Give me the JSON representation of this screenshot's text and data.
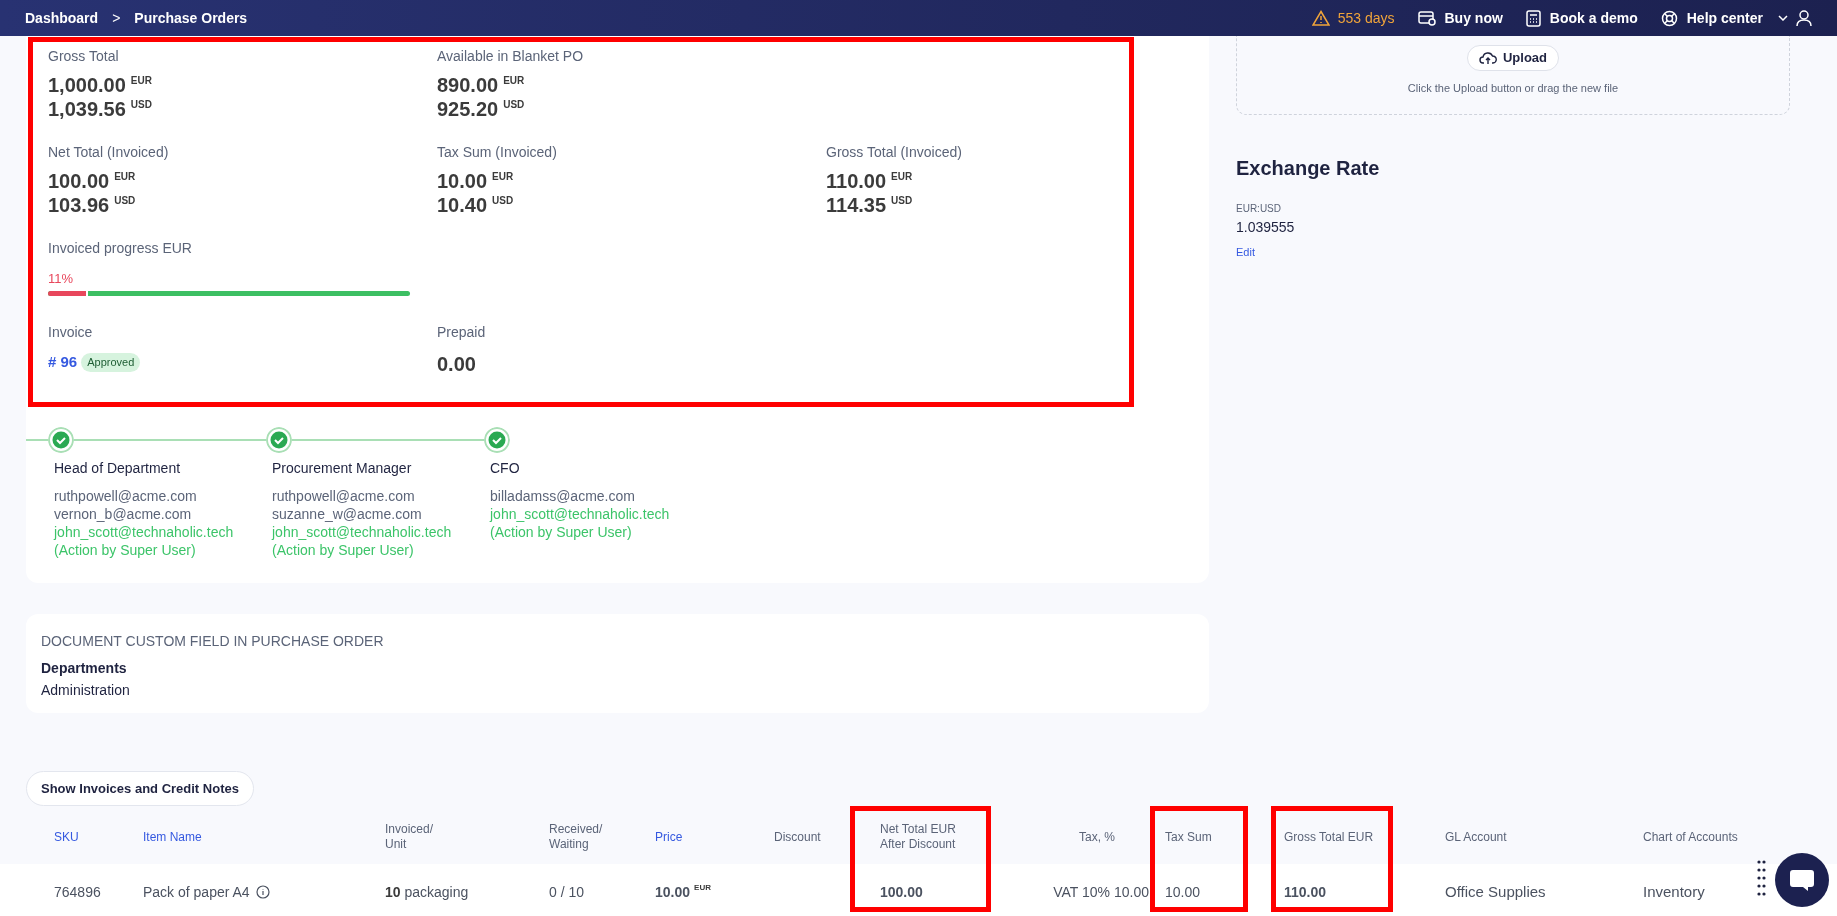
{
  "topbar": {
    "breadcrumbs": [
      "Dashboard",
      "Purchase Orders"
    ],
    "separator": ">",
    "trial": "553 days",
    "actions": [
      "Buy now",
      "Book a demo",
      "Help center"
    ]
  },
  "summary": {
    "rows": [
      {
        "fields": [
          {
            "label": "Gross Total",
            "amounts": [
              {
                "value": "1,000.00",
                "currency": "EUR"
              },
              {
                "value": "1,039.56",
                "currency": "USD"
              }
            ]
          },
          {
            "label": "Available in Blanket PO",
            "amounts": [
              {
                "value": "890.00",
                "currency": "EUR"
              },
              {
                "value": "925.20",
                "currency": "USD"
              }
            ]
          }
        ]
      },
      {
        "fields": [
          {
            "label": "Net Total (Invoiced)",
            "amounts": [
              {
                "value": "100.00",
                "currency": "EUR"
              },
              {
                "value": "103.96",
                "currency": "USD"
              }
            ]
          },
          {
            "label": "Tax Sum (Invoiced)",
            "amounts": [
              {
                "value": "10.00",
                "currency": "EUR"
              },
              {
                "value": "10.40",
                "currency": "USD"
              }
            ]
          },
          {
            "label": "Gross Total (Invoiced)",
            "amounts": [
              {
                "value": "110.00",
                "currency": "EUR"
              },
              {
                "value": "114.35",
                "currency": "USD"
              }
            ]
          }
        ]
      }
    ],
    "progress": {
      "label": "Invoiced progress EUR",
      "reading": "11%",
      "level": 0.11
    },
    "invoice": {
      "label": "Invoice",
      "number": "# 96",
      "status": "Approved"
    },
    "prepaid": {
      "label": "Prepaid",
      "value": "0.00"
    }
  },
  "approval_steps": [
    {
      "role": "Head of Department",
      "completed": true,
      "lines": [
        {
          "text": "ruthpowell@acme.com",
          "acted": false
        },
        {
          "text": "vernon_b@acme.com",
          "acted": false
        },
        {
          "text": "john_scott@technaholic.tech",
          "acted": true
        },
        {
          "text": "(Action by Super User)",
          "acted": true
        }
      ]
    },
    {
      "role": "Procurement Manager",
      "completed": true,
      "lines": [
        {
          "text": "ruthpowell@acme.com",
          "acted": false
        },
        {
          "text": "suzanne_w@acme.com",
          "acted": false
        },
        {
          "text": "john_scott@technaholic.tech",
          "acted": true
        },
        {
          "text": "(Action by Super User)",
          "acted": true
        }
      ]
    },
    {
      "role": "CFO",
      "completed": true,
      "lines": [
        {
          "text": "billadamss@acme.com",
          "acted": false
        },
        {
          "text": "john_scott@technaholic.tech",
          "acted": true
        },
        {
          "text": "(Action by Super User)",
          "acted": true
        }
      ]
    }
  ],
  "custom_fields": {
    "title": "DOCUMENT CUSTOM FIELD IN PURCHASE ORDER",
    "fields": [
      {
        "label": "Departments",
        "value": "Administration"
      }
    ]
  },
  "upload": {
    "button": "Upload",
    "hint": "Click the Upload button or drag the new file"
  },
  "exchange_rate": {
    "title": "Exchange Rate",
    "pair": "EUR:USD",
    "rate": "1.039555",
    "edit": "Edit"
  },
  "show_invoices_button": "Show Invoices and Credit Notes",
  "table": {
    "columns": [
      {
        "label": "SKU",
        "link": true
      },
      {
        "label": "Item Name",
        "link": true
      },
      {
        "label": "Invoiced/\nUnit",
        "link": false
      },
      {
        "label": "Received/\nWaiting",
        "link": false
      },
      {
        "label": "Price",
        "link": true
      },
      {
        "label": "Discount",
        "link": false
      },
      {
        "label": "Net Total EUR\nAfter Discount",
        "link": false
      },
      {
        "label": "Tax, %",
        "link": false
      },
      {
        "label": "Tax Sum",
        "link": false
      },
      {
        "label": "Gross Total EUR",
        "link": false
      },
      {
        "label": "GL Account",
        "link": false
      },
      {
        "label": "Chart of Accounts",
        "link": false
      }
    ],
    "rows": [
      {
        "sku": "764896",
        "item_name": "Pack of paper A4",
        "invoiced": {
          "quantity": "10",
          "unit": "packaging"
        },
        "received": "0 / 10",
        "price": {
          "value": "10.00",
          "currency": "EUR"
        },
        "net_total": "100.00",
        "tax": "VAT 10% 10.00",
        "tax_sum": "10.00",
        "gross_total": "110.00",
        "gl_account": "Office Supplies",
        "chart_of_accounts": "Inventory"
      }
    ]
  }
}
